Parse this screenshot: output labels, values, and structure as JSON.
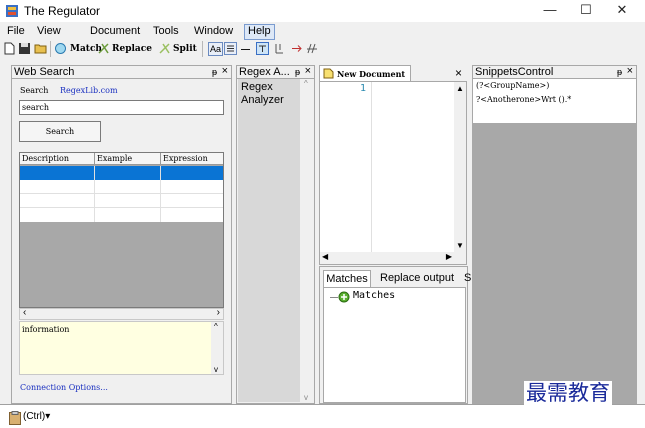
{
  "window": {
    "title": "The Regulator",
    "min": "—",
    "max": "☐",
    "close": "✕"
  },
  "menu": {
    "file": "File",
    "view": "View",
    "document": "Document",
    "tools": "Tools",
    "window": "Window",
    "help": "Help"
  },
  "toolbar": {
    "match": "Match",
    "replace": "Replace",
    "split": "Split",
    "aa": "Aa"
  },
  "web_search": {
    "title": "Web Search",
    "search_label": "Search",
    "site_link": "RegexLib.com",
    "query_value": "search",
    "search_button": "Search",
    "columns": [
      "Description",
      "Example",
      "Expression"
    ],
    "info_text": "information",
    "connection_link": "Connection Options..."
  },
  "regex_analyzer": {
    "tab_title": "Regex A...",
    "body_text": "Regex Analyzer"
  },
  "editor": {
    "tab_title": "New Document",
    "line_number": "1"
  },
  "output_tabs": {
    "matches_tab": "Matches",
    "replace_tab": "Replace output",
    "extra_tab": "S",
    "tree_root": "Matches"
  },
  "snippets": {
    "title": "SnippetsControl",
    "items": [
      "(?<GroupName>)",
      "?<Anotherone>Wrt ().*"
    ]
  },
  "watermark": "最需教育",
  "bottom_tag": "(Ctrl)▾",
  "pin_icon_char": "ᵽ",
  "colors": {
    "selection": "#0a74d4",
    "info_bg": "#ffffe1",
    "gray_area": "#a8a8a8",
    "link": "#1a30c0"
  }
}
